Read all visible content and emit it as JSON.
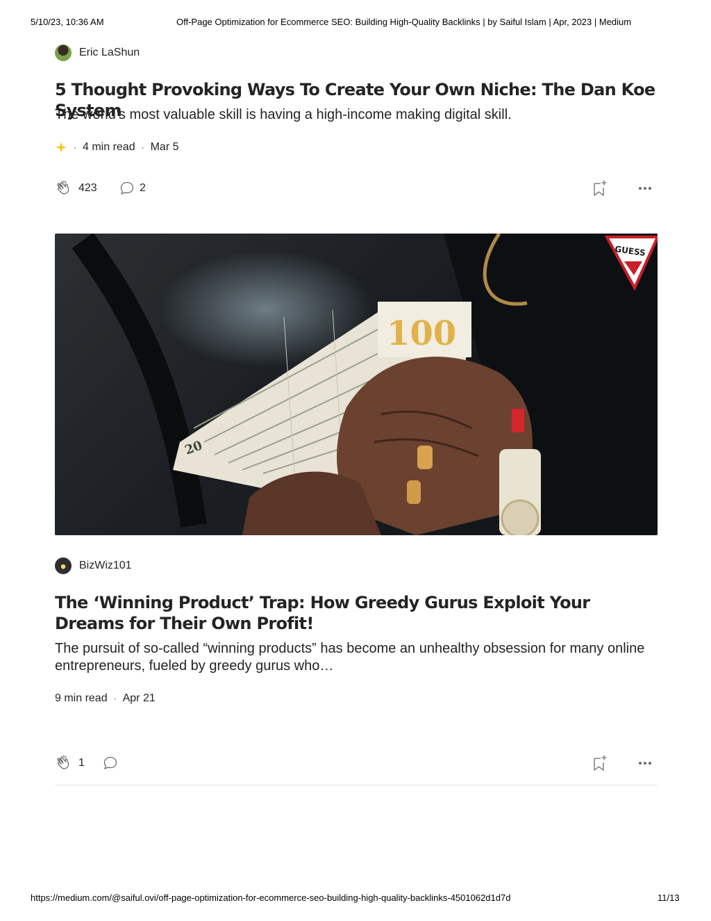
{
  "print_header": {
    "datetime": "5/10/23, 10:36 AM",
    "title": "Off-Page Optimization for Ecommerce SEO: Building High-Quality Backlinks | by Saiful Islam | Apr, 2023 | Medium"
  },
  "posts": [
    {
      "author": "Eric LaShun",
      "title": "5 Thought Provoking Ways To Create Your Own Niche: The Dan Koe System",
      "subtitle": "The world’s most valuable skill is having a high-income making digital skill.",
      "member_only": true,
      "read_time": "4 min read",
      "date": "Mar 5",
      "claps": "423",
      "responses": "2"
    },
    {
      "author": "BizWiz101",
      "title": "The ‘Winning Product’ Trap: How Greedy Gurus Exploit Your Dreams for Their Own Profit!",
      "subtitle": "The pursuit of so-called “winning products” has become an unhealthy obsession for many online entrepreneurs, fueled by greedy gurus who…",
      "member_only": false,
      "read_time": "9 min read",
      "date": "Apr 21",
      "claps": "1",
      "responses": ""
    }
  ],
  "hero_image": {
    "note_text": "100",
    "badge_text": "GUESS"
  },
  "separator": "·",
  "print_footer": {
    "url": "https://medium.com/@saiful.ovi/off-page-optimization-for-ecommerce-seo-building-high-quality-backlinks-4501062d1d7d",
    "page": "11/13"
  },
  "colors": {
    "text": "#242424",
    "star": "#FFC017",
    "icon": "#6B6B6B",
    "divider": "#E6E6E6"
  }
}
